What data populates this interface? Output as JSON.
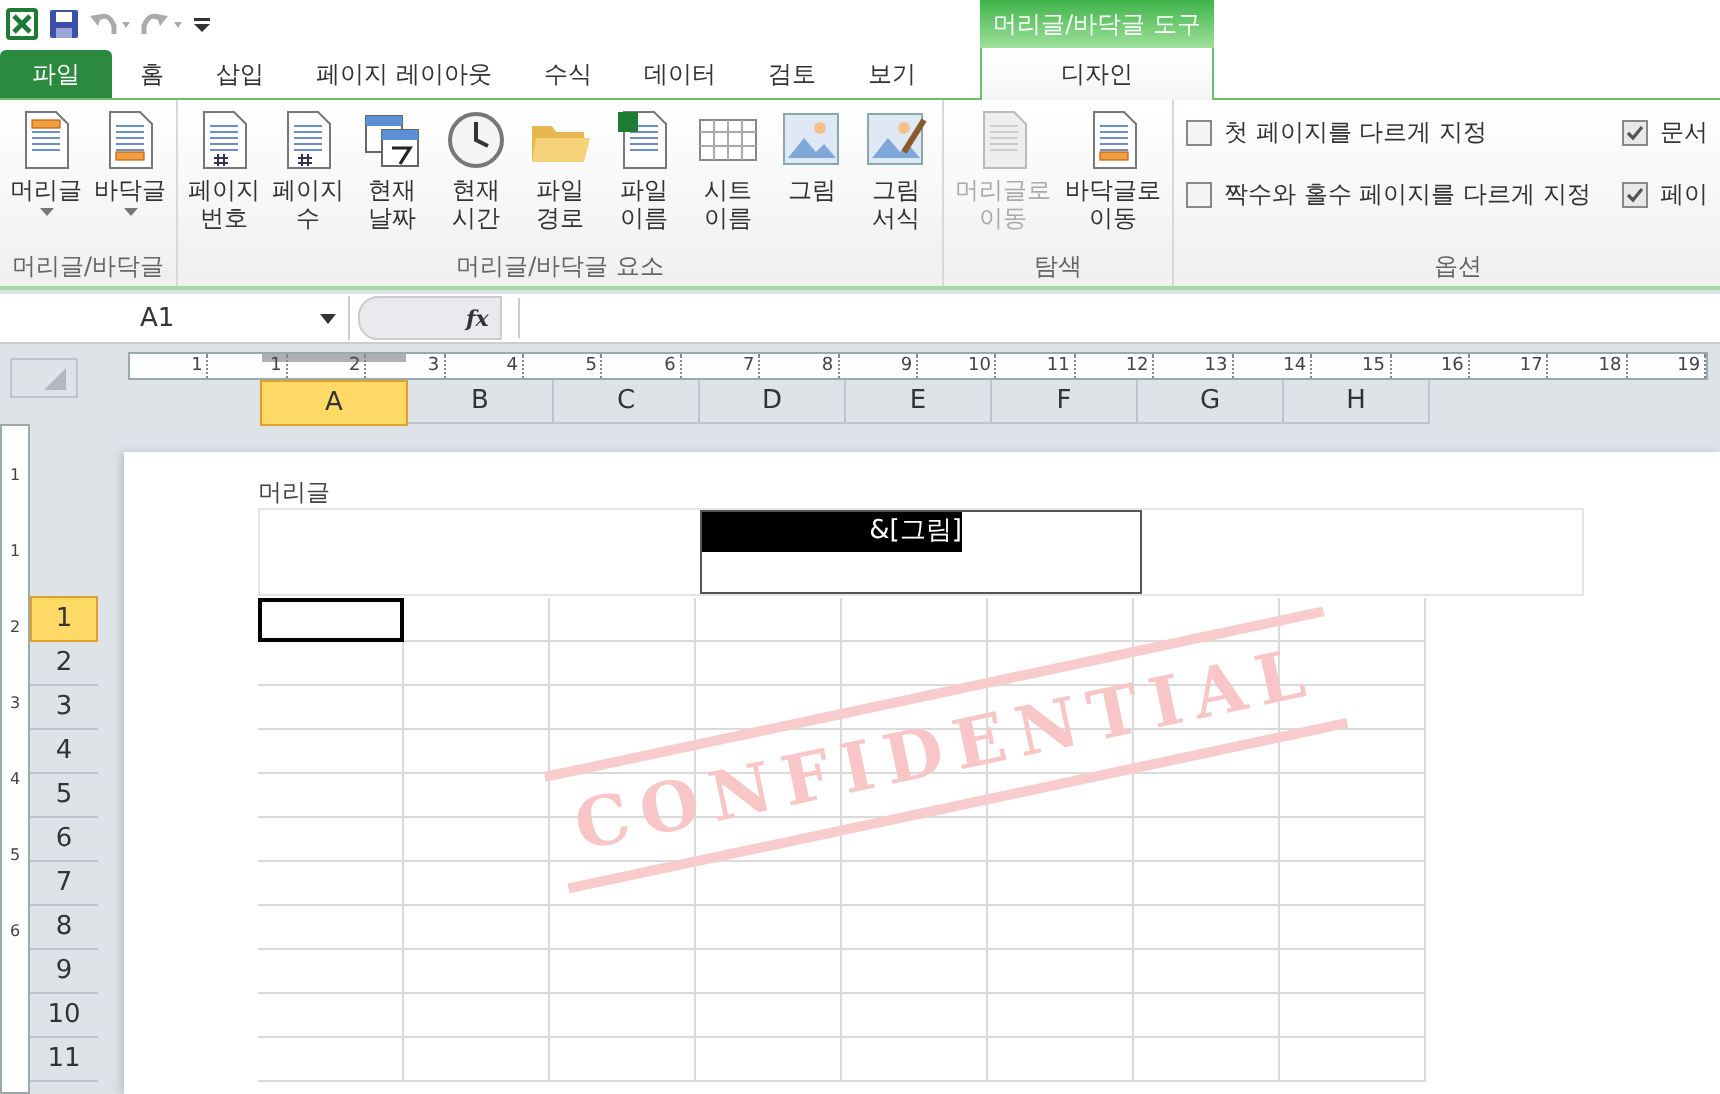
{
  "contextual_group": {
    "label": "머리글/바닥글 도구"
  },
  "tabs": [
    {
      "label": "파일",
      "kind": "file",
      "selected": false
    },
    {
      "label": "홈",
      "kind": "normal",
      "selected": false
    },
    {
      "label": "삽입",
      "kind": "normal",
      "selected": false
    },
    {
      "label": "페이지 레이아웃",
      "kind": "normal",
      "selected": false
    },
    {
      "label": "수식",
      "kind": "normal",
      "selected": false
    },
    {
      "label": "데이터",
      "kind": "normal",
      "selected": false
    },
    {
      "label": "검토",
      "kind": "normal",
      "selected": false
    },
    {
      "label": "보기",
      "kind": "normal",
      "selected": false
    },
    {
      "label": "디자인",
      "kind": "contextual",
      "selected": true
    }
  ],
  "ribbon_groups": [
    {
      "label": "머리글/바닥글",
      "kind": "buttons",
      "buttons": [
        {
          "label": "머리글",
          "dropdown": true,
          "disabled": false
        },
        {
          "label": "바닥글",
          "dropdown": true,
          "disabled": false
        }
      ]
    },
    {
      "label": "머리글/바닥글 요소",
      "kind": "buttons",
      "buttons": [
        {
          "label": "페이지 번호",
          "dropdown": false,
          "disabled": false
        },
        {
          "label": "페이지 수",
          "dropdown": false,
          "disabled": false
        },
        {
          "label": "현재 날짜",
          "dropdown": false,
          "disabled": false
        },
        {
          "label": "현재 시간",
          "dropdown": false,
          "disabled": false
        },
        {
          "label": "파일 경로",
          "dropdown": false,
          "disabled": false
        },
        {
          "label": "파일 이름",
          "dropdown": false,
          "disabled": false
        },
        {
          "label": "시트 이름",
          "dropdown": false,
          "disabled": false
        },
        {
          "label": "그림",
          "dropdown": false,
          "disabled": false
        },
        {
          "label": "그림 서식",
          "dropdown": false,
          "disabled": false
        }
      ]
    },
    {
      "label": "탐색",
      "kind": "buttons",
      "buttons": [
        {
          "label": "머리글로 이동",
          "dropdown": false,
          "disabled": true
        },
        {
          "label": "바닥글로 이동",
          "dropdown": false,
          "disabled": false
        }
      ]
    },
    {
      "label": "옵션",
      "kind": "options",
      "checkboxes": [
        {
          "label": "첫 페이지를 다르게 지정",
          "checked": false
        },
        {
          "label": "문서",
          "checked": true
        },
        {
          "label": "짝수와 홀수 페이지를 다르게 지정",
          "checked": false
        },
        {
          "label": "페이",
          "checked": true
        }
      ]
    }
  ],
  "name_box": {
    "value": "A1"
  },
  "formula_bar": {
    "fx": "fx"
  },
  "top_ruler": [
    "1",
    "1",
    "2",
    "3",
    "4",
    "5",
    "6",
    "7",
    "8",
    "9",
    "10",
    "11",
    "12",
    "13",
    "14",
    "15",
    "16",
    "17",
    "18",
    "19"
  ],
  "left_ruler": [
    "1",
    "1",
    "2",
    "3",
    "4",
    "5",
    "6"
  ],
  "columns": [
    {
      "label": "A",
      "selected": true
    },
    {
      "label": "B",
      "selected": false
    },
    {
      "label": "C",
      "selected": false
    },
    {
      "label": "D",
      "selected": false
    },
    {
      "label": "E",
      "selected": false
    },
    {
      "label": "F",
      "selected": false
    },
    {
      "label": "G",
      "selected": false
    },
    {
      "label": "H",
      "selected": false
    }
  ],
  "rows": [
    {
      "label": "1",
      "selected": true
    },
    {
      "label": "2",
      "selected": false
    },
    {
      "label": "3",
      "selected": false
    },
    {
      "label": "4",
      "selected": false
    },
    {
      "label": "5",
      "selected": false
    },
    {
      "label": "6",
      "selected": false
    },
    {
      "label": "7",
      "selected": false
    },
    {
      "label": "8",
      "selected": false
    },
    {
      "label": "9",
      "selected": false
    },
    {
      "label": "10",
      "selected": false
    },
    {
      "label": "11",
      "selected": false
    }
  ],
  "page": {
    "header_label": "머리글",
    "header_center_text": "&[그림]",
    "stamp_text": "CONFIDENTIAL"
  }
}
